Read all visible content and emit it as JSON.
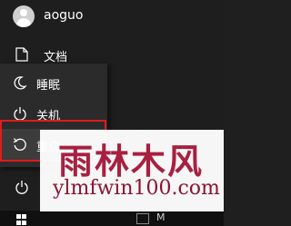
{
  "user": {
    "name": "aoguo"
  },
  "nav": {
    "documents_label": "文档"
  },
  "power_menu": {
    "items": [
      {
        "label": "睡眠",
        "icon": "moon-icon"
      },
      {
        "label": "关机",
        "icon": "power-icon"
      },
      {
        "label": "重启",
        "icon": "restart-icon"
      }
    ],
    "highlight_color": "#e21b1b"
  },
  "taskbar": {
    "app_letter": "M"
  },
  "watermark": {
    "brand": "雨林木风",
    "url": "ylmfwin100.com",
    "color": "#a82040"
  }
}
